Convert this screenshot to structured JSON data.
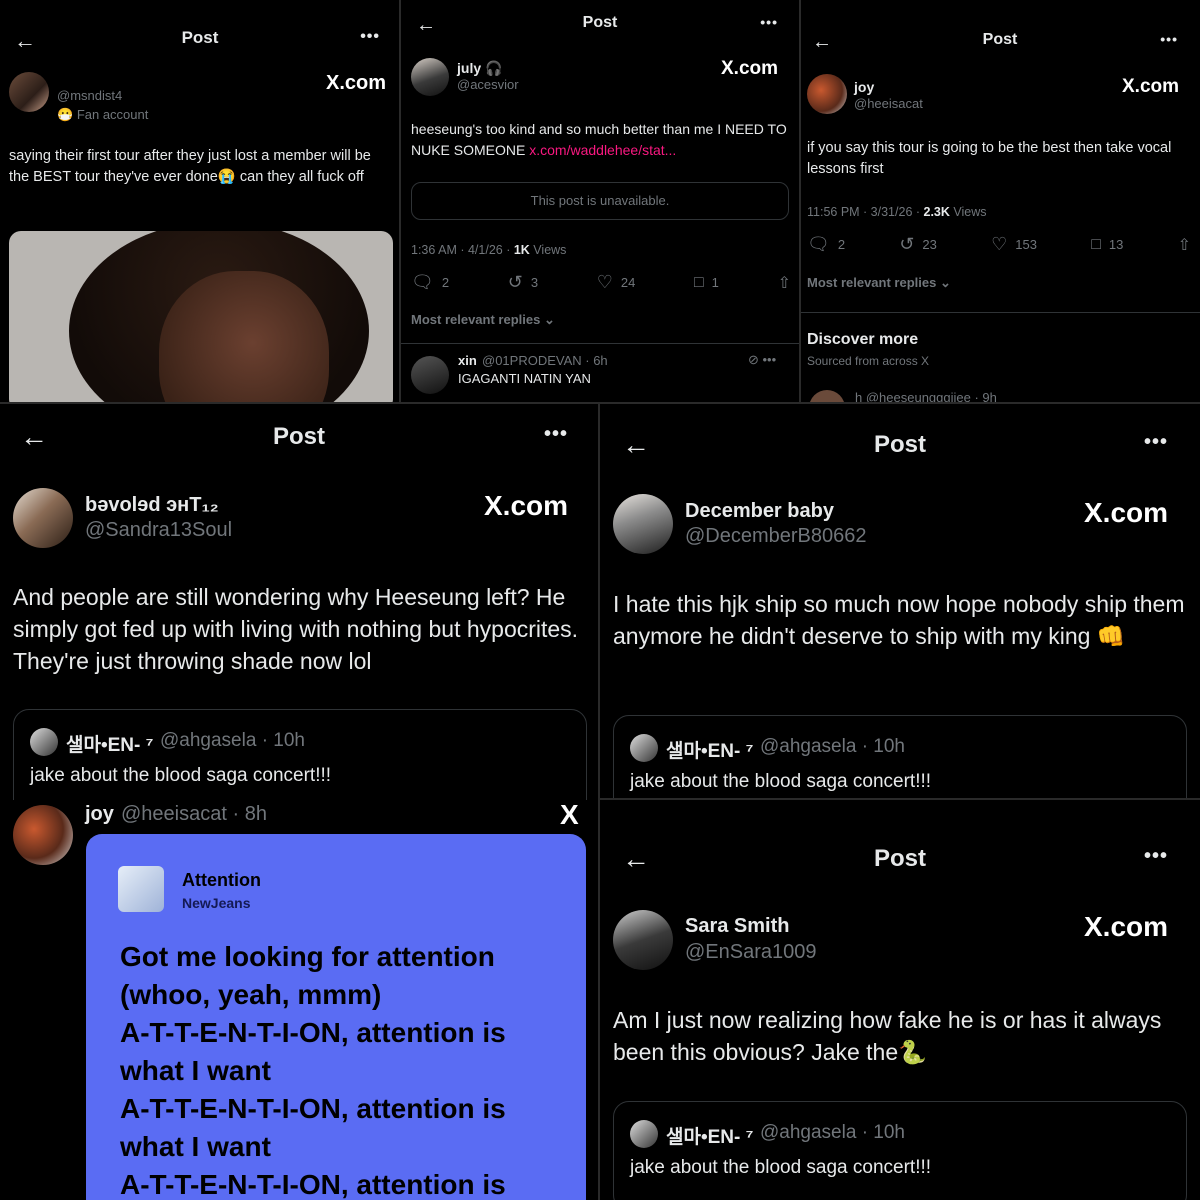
{
  "accent": "#f91880",
  "panel1": {
    "title": "Post",
    "handle": "@msndist4",
    "badge": "Fan account",
    "brand": "X.com",
    "text": "saying their first tour after they just lost a member will be the BEST tour they've ever done😭 can they all fuck off"
  },
  "panel2": {
    "title": "Post",
    "name": "july 🎧",
    "handle": "@acesvior",
    "brand": "X.com",
    "text": "heeseung's too kind and so much better than me I NEED TO NUKE SOMEONE ",
    "link": "x.com/waddlehee/stat...",
    "unavailable": "This post is unavailable.",
    "time": "1:36 AM · 4/1/26 · ",
    "views_count": "1K",
    "views_label": " Views",
    "replies": "2",
    "reposts": "3",
    "likes": "24",
    "bookmarks": "1",
    "relevant": "Most relevant replies ⌄",
    "reply_name": "xin",
    "reply_handle": "@01PRODEVAN · 6h",
    "reply_text": "IGAGANTI NATIN YAN"
  },
  "panel3": {
    "title": "Post",
    "name": "joy",
    "handle": "@heeisacat",
    "brand": "X.com",
    "text": "if you say this tour is going to be the best then take vocal lessons first",
    "time": "11:56 PM · 3/31/26 · ",
    "views_count": "2.3K",
    "views_label": " Views",
    "replies": "2",
    "reposts": "23",
    "likes": "153",
    "bookmarks": "13",
    "relevant": "Most relevant replies ⌄",
    "discover": "Discover more",
    "sourced": "Sourced from across X",
    "next_handle": "h  @heeseungggiiee · 9h"
  },
  "panel4": {
    "title": "Post",
    "name": "bəvolɘd энT₁₂",
    "handle": "@Sandra13Soul",
    "brand": "X.com",
    "text": "And people are still wondering why Heeseung left? He simply got fed up with living with nothing but hypocrites. They're just throwing shade now lol",
    "quote_name": "샐마•EN- ⁷",
    "quote_handle": "@ahgasela · 10h",
    "quote_text": "jake about the blood saga concert!!!"
  },
  "panel5": {
    "title": "Post",
    "name": "December baby",
    "handle": "@DecemberB80662",
    "brand": "X.com",
    "text": "I hate this hjk ship so much now hope nobody ship them anymore he didn't deserve to ship with my king 👊",
    "quote_name": "샐마•EN- ⁷",
    "quote_handle": "@ahgasela · 10h",
    "quote_text": "jake about the blood saga concert!!!"
  },
  "panel6": {
    "name": "joy",
    "handle": "@heeisacat · 8h",
    "brand": "X",
    "song": "Attention",
    "artist": "NewJeans",
    "lyrics": [
      "Got me looking for attention",
      "(whoo, yeah, mmm)",
      "A-T-T-E-N-T-I-ON, attention is",
      "what I want",
      "A-T-T-E-N-T-I-ON, attention is",
      "what I want",
      "A-T-T-E-N-T-I-ON, attention is"
    ]
  },
  "panel7": {
    "title": "Post",
    "name": "Sara Smith",
    "handle": "@EnSara1009",
    "brand": "X.com",
    "text": "Am I just now realizing how  fake he is or has it always been this obvious?  Jake the🐍",
    "quote_name": "샐마•EN- ⁷",
    "quote_handle": "@ahgasela · 10h",
    "quote_text": "jake about the blood saga concert!!!"
  }
}
